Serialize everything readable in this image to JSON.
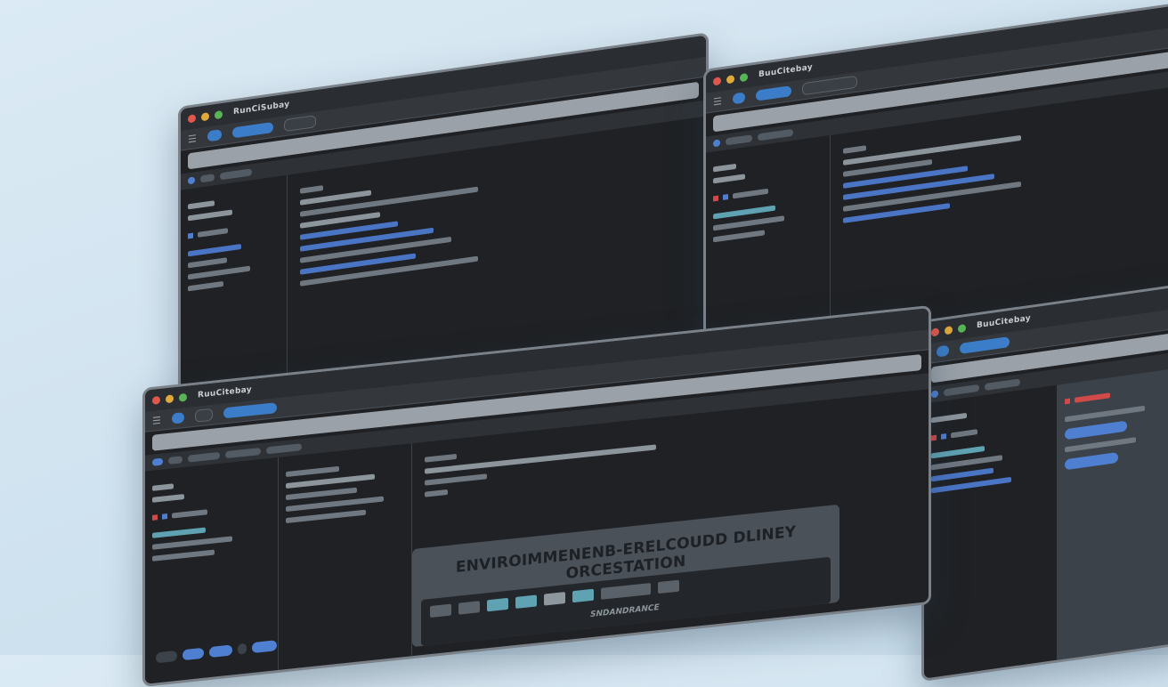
{
  "windows": {
    "back_left": {
      "title": "RunCiSubay"
    },
    "back_right": {
      "title": "BuuCitebay"
    },
    "front": {
      "title": "RuuCitebay"
    },
    "side": {
      "title": "BuuCitebay"
    }
  },
  "banner": {
    "title": "ENVIROIMMENENB-ERELCOUDD DLINEY ORCESTATION",
    "tray_label": "SNDANDRANCE"
  },
  "colors": {
    "accent": "#3b7dc8",
    "window_bg": "#1f2124",
    "teal": "#5fa3b3",
    "danger": "#d04a4a"
  }
}
